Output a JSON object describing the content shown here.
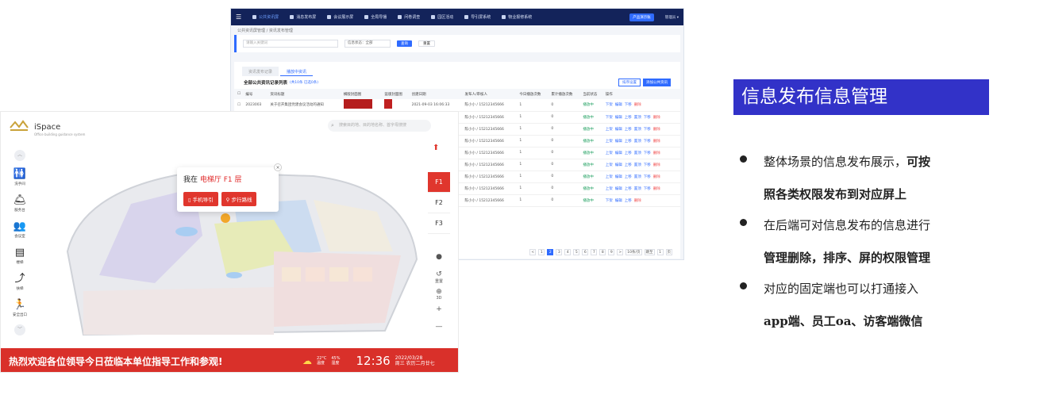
{
  "admin": {
    "nav": {
      "items": [
        "公共资讯屏",
        "消息发布屏",
        "会议展示屏",
        "全局导播",
        "问卷调查",
        "园区活动",
        "导引屏系统",
        "物业报修系统"
      ],
      "user_button": "产品演示账",
      "user_name": "管理员 ▾"
    },
    "breadcrumb": "公共资讯屏管理 / 资讯发布管理",
    "filter": {
      "search_placeholder": "请输入关键词",
      "status_select": "信息状态：全部",
      "query_label": "查询",
      "reset_label": "重置"
    },
    "tabs": [
      "资讯发布记录",
      "播放中资讯"
    ],
    "list": {
      "title": "全部公共资讯记录列表",
      "count": "(共10条  已选0条)",
      "sort_label": "排序设置",
      "add_label": "添加公共资讯"
    },
    "columns": [
      "编号",
      "资讯标题",
      "横版封面图",
      "竖版封面图",
      "创建日期",
      "发布人/审核人",
      "今日播放次数",
      "累计播放次数",
      "当前状态",
      "操作"
    ],
    "rows": [
      {
        "id": "2023003",
        "title": "关于召开集团党建会议活动的通知",
        "date": "2021-09-03 16:06:33",
        "person": "陈小小 / 15212345666",
        "today": "1",
        "total": "0",
        "status": "播放中",
        "ops": [
          "下架",
          "编辑",
          "下移",
          "删除"
        ]
      },
      {
        "id": "",
        "title": "",
        "date": "",
        "person": "陈小小 / 15212345666",
        "today": "1",
        "total": "0",
        "status": "播放中",
        "ops": [
          "下架",
          "编辑",
          "上移",
          "置顶",
          "下移",
          "删除"
        ]
      },
      {
        "id": "",
        "title": "",
        "date": "",
        "person": "陈小小 / 15212345666",
        "today": "1",
        "total": "0",
        "status": "播放中",
        "ops": [
          "上架",
          "编辑",
          "上移",
          "置顶",
          "下移",
          "删除"
        ]
      },
      {
        "id": "",
        "title": "",
        "date": "",
        "person": "陈小小 / 15212345666",
        "today": "1",
        "total": "0",
        "status": "播放中",
        "ops": [
          "上架",
          "编辑",
          "上移",
          "置顶",
          "下移",
          "删除"
        ]
      },
      {
        "id": "",
        "title": "",
        "date": "",
        "person": "陈小小 / 15212345666",
        "today": "1",
        "total": "0",
        "status": "播放中",
        "ops": [
          "上架",
          "编辑",
          "上移",
          "置顶",
          "下移",
          "删除"
        ]
      },
      {
        "id": "",
        "title": "",
        "date": "",
        "person": "陈小小 / 15212345666",
        "today": "1",
        "total": "0",
        "status": "播放中",
        "ops": [
          "上架",
          "编辑",
          "上移",
          "置顶",
          "下移",
          "删除"
        ]
      },
      {
        "id": "",
        "title": "",
        "date": "",
        "person": "陈小小 / 15212345666",
        "today": "1",
        "total": "0",
        "status": "播放中",
        "ops": [
          "上架",
          "编辑",
          "上移",
          "置顶",
          "下移",
          "删除"
        ]
      },
      {
        "id": "",
        "title": "",
        "date": "",
        "person": "陈小小 / 15212345666",
        "today": "1",
        "total": "0",
        "status": "播放中",
        "ops": [
          "上架",
          "编辑",
          "上移",
          "置顶",
          "下移",
          "删除"
        ]
      },
      {
        "id": "",
        "title": "",
        "date": "",
        "person": "陈小小 / 15212345666",
        "today": "1",
        "total": "0",
        "status": "播放中",
        "ops": [
          "下架",
          "编辑",
          "上移",
          "删除"
        ]
      }
    ],
    "pager": [
      "<",
      "1",
      "2",
      "3",
      "4",
      "5",
      "6",
      "7",
      "8",
      "9",
      ">",
      "10条/页",
      "跳至",
      "1",
      "页"
    ],
    "pager_active": "2"
  },
  "kiosk": {
    "brand": "iSpace",
    "brand_sub": "Office building guidance system",
    "search_placeholder": "搜索目的地、目的地名称、首字母搜搜",
    "sidebar": [
      {
        "label": "洗手间",
        "icon": "restroom-icon",
        "glyph": "🚻"
      },
      {
        "label": "服务台",
        "icon": "service-desk-icon",
        "glyph": "🛎"
      },
      {
        "label": "会议室",
        "icon": "meeting-room-icon",
        "glyph": "👥"
      },
      {
        "label": "楼梯",
        "icon": "stairs-icon",
        "glyph": "▤"
      },
      {
        "label": "扶梯",
        "icon": "escalator-icon",
        "glyph": "⤴"
      },
      {
        "label": "安全出口",
        "icon": "exit-icon",
        "glyph": "🏃"
      }
    ],
    "popup": {
      "prefix": "我在 ",
      "location": "电梯厅 F1 层",
      "phone_nav": "手机导引",
      "walk_route": "步行路线"
    },
    "floors": [
      "F1",
      "F2",
      "F3"
    ],
    "tools": [
      {
        "label": "",
        "glyph": "●"
      },
      {
        "label": "重置",
        "glyph": "↺"
      },
      {
        "label": "3D",
        "glyph": "⊕"
      },
      {
        "label": "",
        "glyph": "+"
      },
      {
        "label": "",
        "glyph": "—"
      }
    ],
    "banner": {
      "message": "热烈欢迎各位领导今日莅临本单位指导工作和参观!",
      "temp": "22°C",
      "temp_label": "温度",
      "humidity": "45%",
      "humidity_label": "湿度",
      "time": "12:36",
      "date": "2022/03/28",
      "weekday": "周三 农历二月廿七"
    }
  },
  "headline": "信息发布信息管理",
  "bullets": [
    {
      "line1": "整体场景的信息发布展示，",
      "line1_bold": "可按",
      "line2": "照各类权限发布到对应屏上"
    },
    {
      "line1": "在后端可对信息发布的信息进行",
      "line1_bold": "",
      "line2": "管理删除，排序、屏的权限管理"
    },
    {
      "line1": "对应的固定端也可以打通接入",
      "line1_bold": "",
      "line2": "app端、员工oa、访客端微信"
    }
  ]
}
